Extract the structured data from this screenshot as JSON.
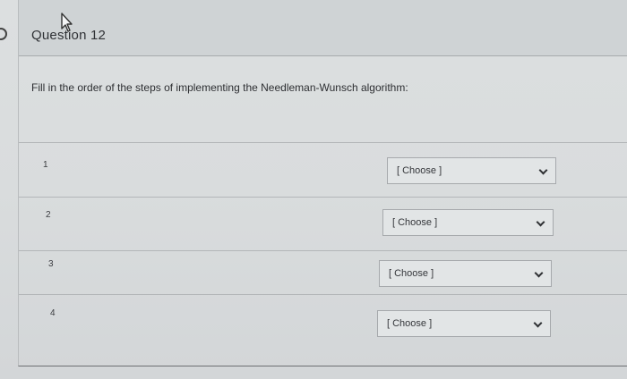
{
  "question": {
    "title": "Question 12",
    "instructions": "Fill in the order of the steps of implementing the Needleman-Wunsch algorithm:"
  },
  "rows": [
    {
      "number": "1",
      "select_value": "[ Choose ]"
    },
    {
      "number": "2",
      "select_value": "[ Choose ]"
    },
    {
      "number": "3",
      "select_value": "[ Choose ]"
    },
    {
      "number": "4",
      "select_value": "[ Choose ]"
    }
  ],
  "icons": {
    "cursor": "mouse-pointer-icon",
    "chevron": "chevron-down-icon",
    "nav": "circle-nav-icon"
  },
  "colors": {
    "background": "#d9dcdd",
    "header": "#cfd3d5",
    "select": "#e2e5e6"
  }
}
